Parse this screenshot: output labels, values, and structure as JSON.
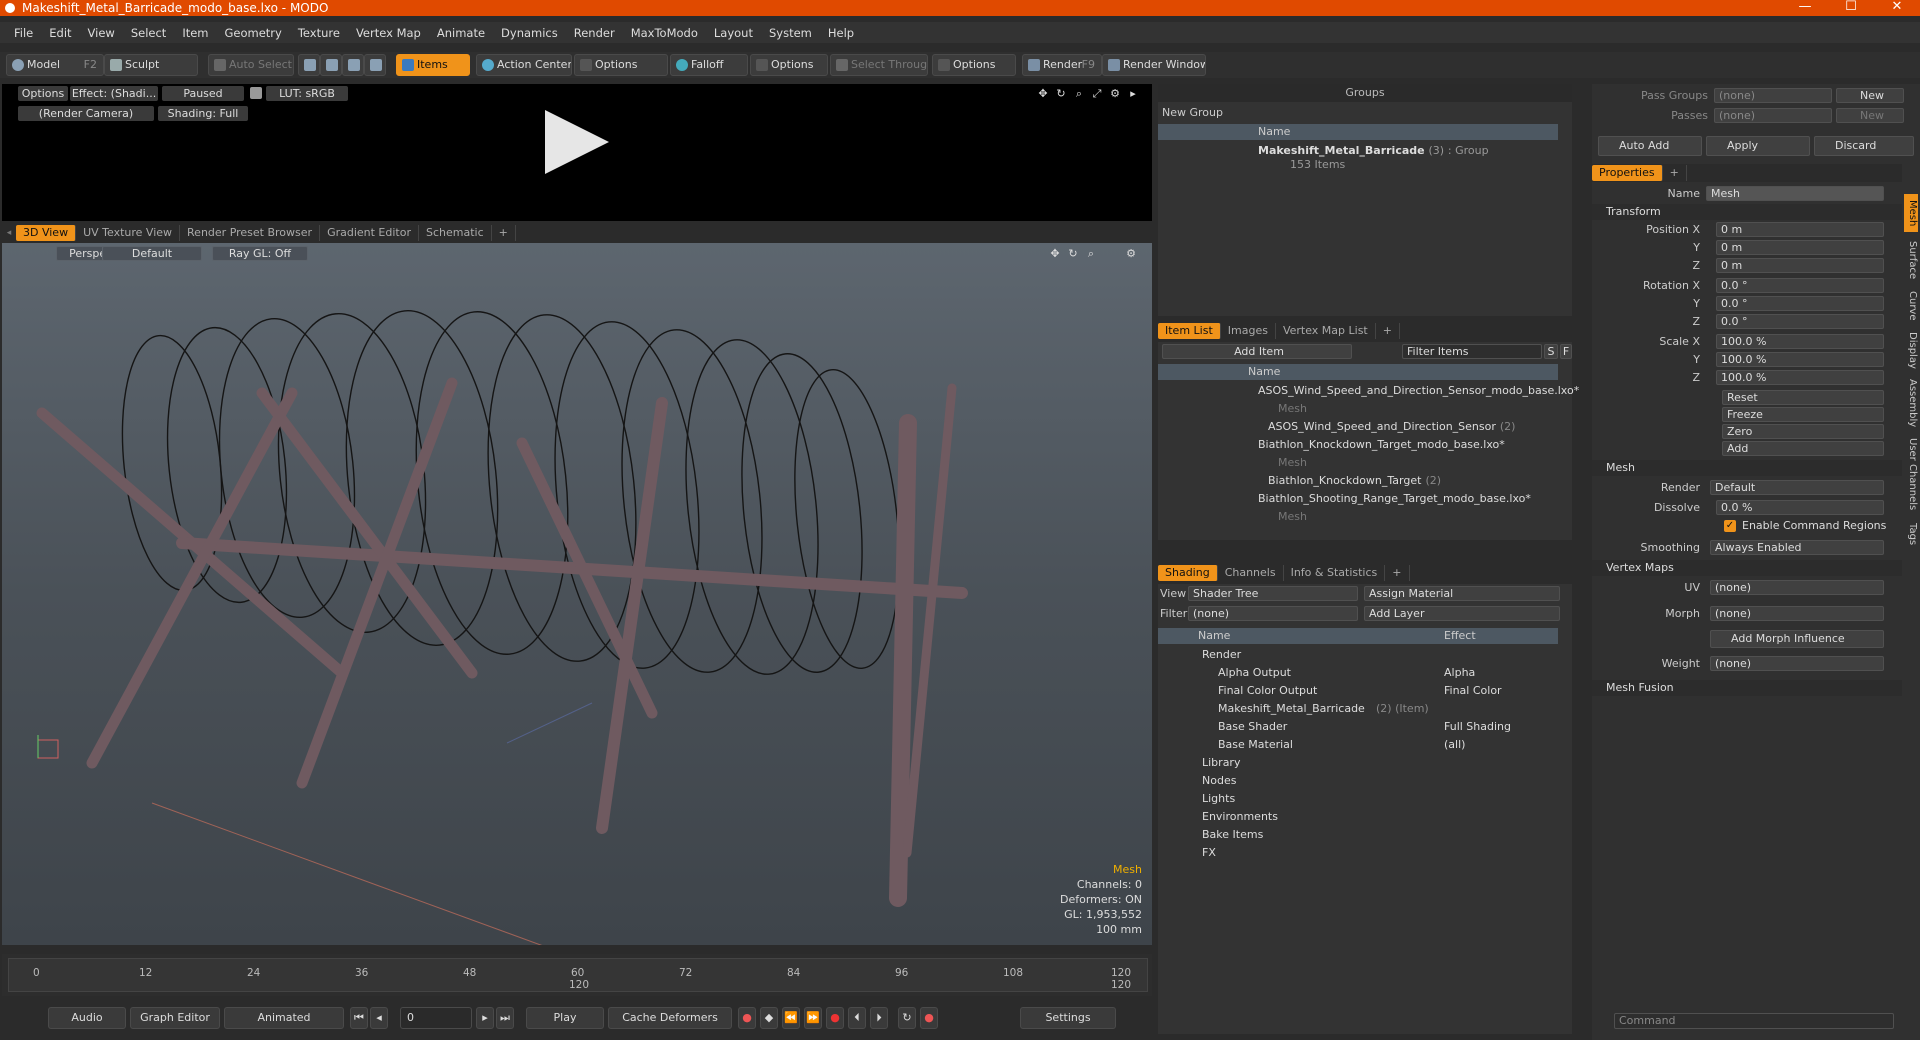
{
  "window": {
    "title": "Makeshift_Metal_Barricade_modo_base.lxo - MODO",
    "minimize": "—",
    "maximize": "☐",
    "close": "✕"
  },
  "menu": [
    "File",
    "Edit",
    "View",
    "Select",
    "Item",
    "Geometry",
    "Texture",
    "Vertex Map",
    "Animate",
    "Dynamics",
    "Render",
    "MaxToModo",
    "Layout",
    "System",
    "Help"
  ],
  "toolbar": {
    "model": "Model",
    "model_key": "F2",
    "sculpt": "Sculpt",
    "auto_select": "Auto Select",
    "items": "Items",
    "action_center": "Action Center",
    "options1": "Options",
    "falloff": "Falloff",
    "options2": "Options",
    "select_through": "Select Through",
    "options3": "Options",
    "render": "Render",
    "render_key": "F9",
    "render_window": "Render Window"
  },
  "preview": {
    "options": "Options",
    "effect": "Effect: (Shadi...",
    "paused": "Paused",
    "lut": "LUT: sRGB",
    "camera": "(Render Camera)",
    "shading": "Shading: Full"
  },
  "viewport_tabs": [
    "3D View",
    "UV Texture View",
    "Render Preset Browser",
    "Gradient Editor",
    "Schematic",
    "+"
  ],
  "viewport": {
    "perspective": "Perspective",
    "default": "Default",
    "raygl": "Ray GL: Off",
    "info_title": "Mesh",
    "channels": "Channels: 0",
    "deformers": "Deformers: ON",
    "gl": "GL: 1,953,552",
    "unit": "100 mm"
  },
  "timeline": {
    "ticks": [
      "0",
      "12",
      "24",
      "36",
      "48",
      "60",
      "72",
      "84",
      "96",
      "108",
      "120"
    ],
    "end_a": "120",
    "end_b": "120"
  },
  "bottombar": {
    "audio": "Audio",
    "graph_editor": "Graph Editor",
    "animated": "Animated",
    "frame": "0",
    "play": "Play",
    "cache": "Cache Deformers",
    "settings": "Settings"
  },
  "groups": {
    "title": "Groups",
    "new_group": "New Group",
    "col_name": "Name",
    "item_name": "Makeshift_Metal_Barricade",
    "item_count": "(3)",
    "item_type": ": Group",
    "item_sub": "153 Items"
  },
  "itemlist": {
    "tabs": [
      "Item List",
      "Images",
      "Vertex Map List",
      "+"
    ],
    "add_item": "Add Item",
    "filter": "Filter Items",
    "s": "S",
    "f": "F",
    "col_name": "Name",
    "rows": [
      {
        "text": "ASOS_Wind_Speed_and_Direction_Sensor_modo_base.lxo*",
        "indent": 0,
        "dim": false,
        "count": ""
      },
      {
        "text": "Mesh",
        "indent": 2,
        "dim": true,
        "count": ""
      },
      {
        "text": "ASOS_Wind_Speed_and_Direction_Sensor",
        "indent": 1,
        "dim": false,
        "count": "(2)"
      },
      {
        "text": "Biathlon_Knockdown_Target_modo_base.lxo*",
        "indent": 0,
        "dim": false,
        "count": ""
      },
      {
        "text": "Mesh",
        "indent": 2,
        "dim": true,
        "count": ""
      },
      {
        "text": "Biathlon_Knockdown_Target",
        "indent": 1,
        "dim": false,
        "count": "(2)"
      },
      {
        "text": "Biathlon_Shooting_Range_Target_modo_base.lxo*",
        "indent": 0,
        "dim": false,
        "count": ""
      },
      {
        "text": "Mesh",
        "indent": 2,
        "dim": true,
        "count": ""
      }
    ]
  },
  "shading": {
    "tabs": [
      "Shading",
      "Channels",
      "Info & Statistics",
      "+"
    ],
    "view_label": "View",
    "view_value": "Shader Tree",
    "assign": "Assign Material",
    "filter_label": "Filter",
    "filter_value": "(none)",
    "add_layer": "Add Layer",
    "col_name": "Name",
    "col_effect": "Effect",
    "rows": [
      {
        "name": "Render",
        "effect": "",
        "indent": 0
      },
      {
        "name": "Alpha Output",
        "effect": "Alpha",
        "indent": 1
      },
      {
        "name": "Final Color Output",
        "effect": "Final Color",
        "indent": 1
      },
      {
        "name": "Makeshift_Metal_Barricade",
        "extra": "(2) (Item)",
        "effect": "",
        "indent": 1
      },
      {
        "name": "Base Shader",
        "effect": "Full Shading",
        "indent": 1
      },
      {
        "name": "Base Material",
        "effect": "(all)",
        "indent": 1
      },
      {
        "name": "Library",
        "effect": "",
        "indent": 0
      },
      {
        "name": "Nodes",
        "effect": "",
        "indent": 0
      },
      {
        "name": "Lights",
        "effect": "",
        "indent": 0
      },
      {
        "name": "Environments",
        "effect": "",
        "indent": 0
      },
      {
        "name": "Bake Items",
        "effect": "",
        "indent": 0
      },
      {
        "name": "FX",
        "effect": "",
        "indent": 0
      }
    ]
  },
  "passes": {
    "pass_groups": "Pass Groups",
    "pass_value": "(none)",
    "new": "New",
    "passes": "Passes",
    "passes_value": "(none)",
    "new2": "New",
    "auto_add": "Auto Add",
    "apply": "Apply",
    "discard": "Discard"
  },
  "properties": {
    "tab": "Properties",
    "plus": "+",
    "name_label": "Name",
    "name_value": "Mesh",
    "transform": "Transform",
    "pos_label": "Position X",
    "y": "Y",
    "z": "Z",
    "pos": [
      "0 m",
      "0 m",
      "0 m"
    ],
    "rot_label": "Rotation X",
    "rot": [
      "0.0 °",
      "0.0 °",
      "0.0 °"
    ],
    "scale_label": "Scale X",
    "scale": [
      "100.0 %",
      "100.0 %",
      "100.0 %"
    ],
    "reset": "Reset",
    "freeze": "Freeze",
    "zero": "Zero",
    "add": "Add",
    "mesh": "Mesh",
    "render_label": "Render",
    "render_value": "Default",
    "dissolve_label": "Dissolve",
    "dissolve_value": "0.0 %",
    "enable_cmd": "Enable Command Regions",
    "smoothing_label": "Smoothing",
    "smoothing_value": "Always Enabled",
    "vertex_maps": "Vertex Maps",
    "uv_label": "UV",
    "uv_value": "(none)",
    "morph_label": "Morph",
    "morph_value": "(none)",
    "add_morph": "Add Morph Influence",
    "weight_label": "Weight",
    "weight_value": "(none)",
    "mesh_fusion": "Mesh Fusion"
  },
  "side_tabs": [
    "Mesh",
    "Surface",
    "Curve",
    "Display",
    "Assembly",
    "User Channels",
    "Tags"
  ],
  "command": {
    "placeholder": "Command"
  }
}
